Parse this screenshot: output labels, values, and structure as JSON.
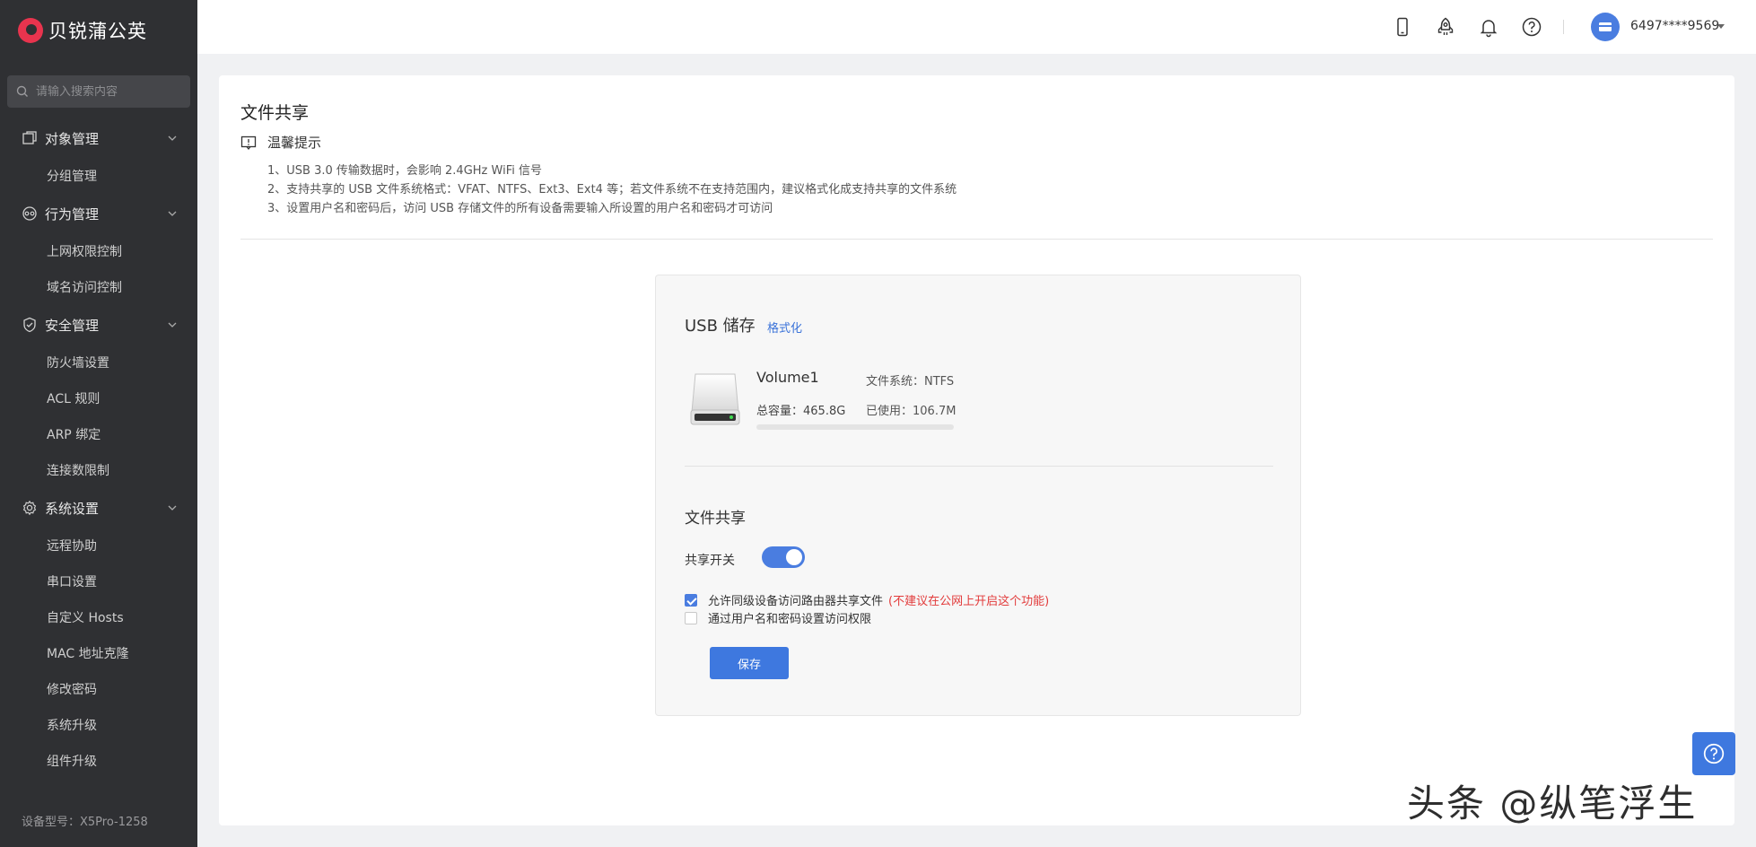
{
  "brand": {
    "name": "贝锐蒲公英"
  },
  "search": {
    "placeholder": "请输入搜索内容"
  },
  "sidebar": {
    "groups": [
      {
        "label": "对象管理",
        "icon": "object-icon",
        "items": [
          "分组管理"
        ]
      },
      {
        "label": "行为管理",
        "icon": "behavior-icon",
        "items": [
          "上网权限控制",
          "域名访问控制"
        ]
      },
      {
        "label": "安全管理",
        "icon": "shield-icon",
        "items": [
          "防火墙设置",
          "ACL 规则",
          "ARP 绑定",
          "连接数限制"
        ]
      },
      {
        "label": "系统设置",
        "icon": "gear-icon",
        "items": [
          "远程协助",
          "串口设置",
          "自定义 Hosts",
          "MAC 地址克隆",
          "修改密码",
          "系统升级",
          "组件升级"
        ]
      }
    ],
    "device_model": "设备型号：X5Pro-1258"
  },
  "header": {
    "icons": [
      "phone-icon",
      "rocket-icon",
      "bell-icon",
      "help-icon"
    ],
    "user_id": "6497****9569"
  },
  "page": {
    "title": "文件共享",
    "tip_label": "温馨提示",
    "tips": [
      "1、USB 3.0 传输数据时，会影响 2.4GHz WiFi 信号",
      "2、支持共享的 USB 文件系统格式：VFAT、NTFS、Ext3、Ext4 等；若文件系统不在支持范围内，建议格式化成支持共享的文件系统",
      "3、设置用户名和密码后，访问 USB 存储文件的所有设备需要输入所设置的用户名和密码才可访问"
    ]
  },
  "usb": {
    "title": "USB 储存",
    "format_link": "格式化",
    "volume_name": "Volume1",
    "filesystem": "文件系统：NTFS",
    "capacity": "总容量：465.8G",
    "used": "已使用：106.7M",
    "used_fraction": 0.0002
  },
  "share": {
    "title": "文件共享",
    "toggle_label": "共享开关",
    "toggle_on": true,
    "allow_label": "允许同级设备访问路由器共享文件",
    "allow_warning": "(不建议在公网上开启这个功能)",
    "allow_checked": true,
    "auth_label": "通过用户名和密码设置访问权限",
    "auth_checked": false,
    "save_label": "保存"
  },
  "watermark": "头条 @纵笔浮生",
  "colors": {
    "accent": "#3e78df",
    "sidebar_bg": "#2f3033",
    "brand": "#e8344e",
    "warning": "#e23b3b"
  }
}
